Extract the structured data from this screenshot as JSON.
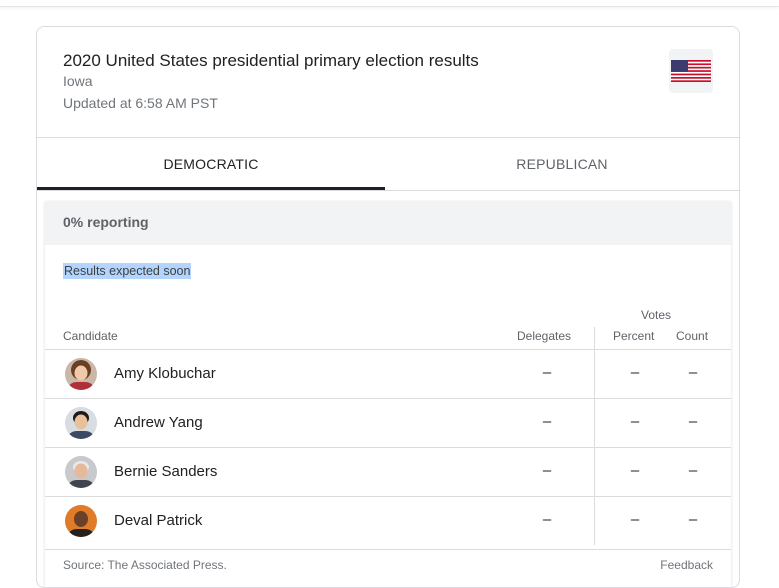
{
  "card": {
    "title": "2020 United States presidential primary election results",
    "state": "Iowa",
    "updated": "Updated at 6:58 AM PST",
    "flag_icon": "us-flag-icon"
  },
  "tabs": [
    {
      "label": "DEMOCRATIC",
      "selected": true
    },
    {
      "label": "REPUBLICAN",
      "selected": false
    }
  ],
  "results": {
    "reporting": "0% reporting",
    "expected": "Results expected soon",
    "votes_header": "Votes",
    "columns": {
      "candidate": "Candidate",
      "delegates": "Delegates",
      "percent": "Percent",
      "count": "Count"
    },
    "candidates": [
      {
        "name": "Amy Klobuchar",
        "delegates": "–",
        "percent": "–",
        "count": "–"
      },
      {
        "name": "Andrew Yang",
        "delegates": "–",
        "percent": "–",
        "count": "–"
      },
      {
        "name": "Bernie Sanders",
        "delegates": "–",
        "percent": "–",
        "count": "–"
      },
      {
        "name": "Deval Patrick",
        "delegates": "–",
        "percent": "–",
        "count": "–"
      }
    ]
  },
  "footer": {
    "source": "Source: The Associated Press.",
    "feedback": "Feedback"
  },
  "colors": {
    "text_primary": "#202124",
    "text_secondary": "#70757a",
    "border": "#dadce0",
    "reporting_bg": "#f1f3f4",
    "selection_highlight": "#b3d4fc"
  }
}
